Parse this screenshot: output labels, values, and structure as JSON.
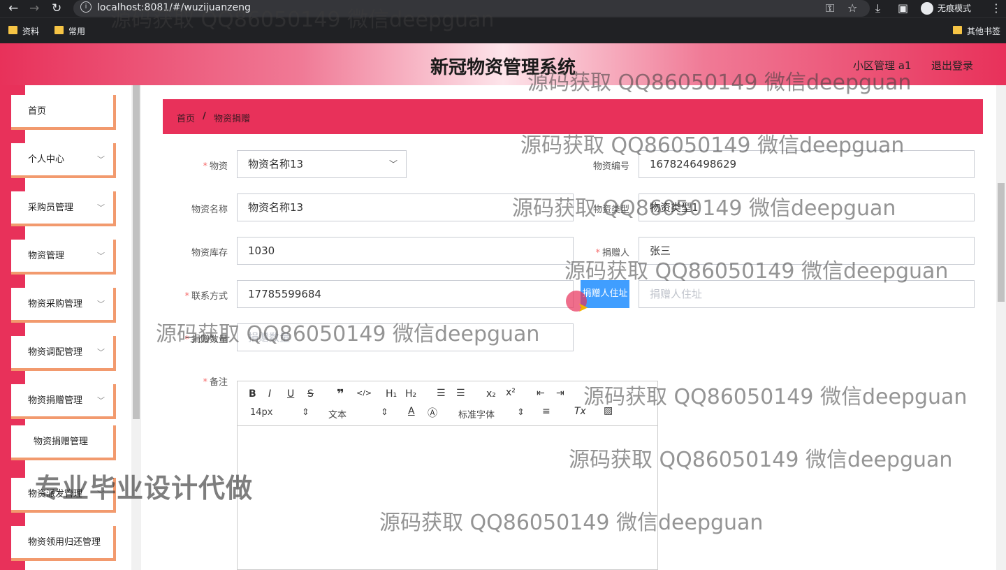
{
  "browser": {
    "url": "localhost:8081/#/wuzijuanzeng",
    "incognito_label": "无痕模式",
    "bookmarks": [
      "资料",
      "常用"
    ],
    "other_bookmarks": "其他书签"
  },
  "header": {
    "title": "新冠物资管理系统",
    "user": "小区管理 a1",
    "logout": "退出登录"
  },
  "sidebar": {
    "items": [
      {
        "label": "首页"
      },
      {
        "label": "个人中心"
      },
      {
        "label": "采购员管理"
      },
      {
        "label": "物资管理"
      },
      {
        "label": "物资采购管理"
      },
      {
        "label": "物资调配管理"
      },
      {
        "label": "物资捐赠管理"
      },
      {
        "label": "物资捐赠管理"
      },
      {
        "label": "物资派发管理"
      },
      {
        "label": "物资领用归还管理"
      }
    ]
  },
  "breadcrumb": {
    "home": "首页",
    "sep": "/",
    "current": "物资捐赠"
  },
  "form": {
    "wuzi": {
      "label": "物资",
      "value": "物资名称13"
    },
    "wuzibianhao": {
      "label": "物资编号",
      "value": "1678246498629"
    },
    "wuzimingcheng": {
      "label": "物资名称",
      "value": "物资名称13"
    },
    "wuzileixing": {
      "label": "物资类型",
      "value": "物资类型1"
    },
    "wuzikucun": {
      "label": "物资库存",
      "value": "1030"
    },
    "juanzengren": {
      "label": "捐赠人",
      "value": "张三"
    },
    "lianxifangshi": {
      "label": "联系方式",
      "value": "17785599684"
    },
    "zhuzhi": {
      "label": "捐赠人住址",
      "placeholder": "捐赠人住址"
    },
    "shuliang": {
      "label": "捐赠数量",
      "placeholder": "捐赠数量"
    },
    "beizhu": {
      "label": "备注"
    }
  },
  "editor": {
    "font_size": "14px",
    "block": "文本",
    "font_family": "标准字体"
  },
  "watermarks": {
    "line": "源码获取 QQ86050149 微信deepguan",
    "big": "专业毕业设计代做"
  }
}
